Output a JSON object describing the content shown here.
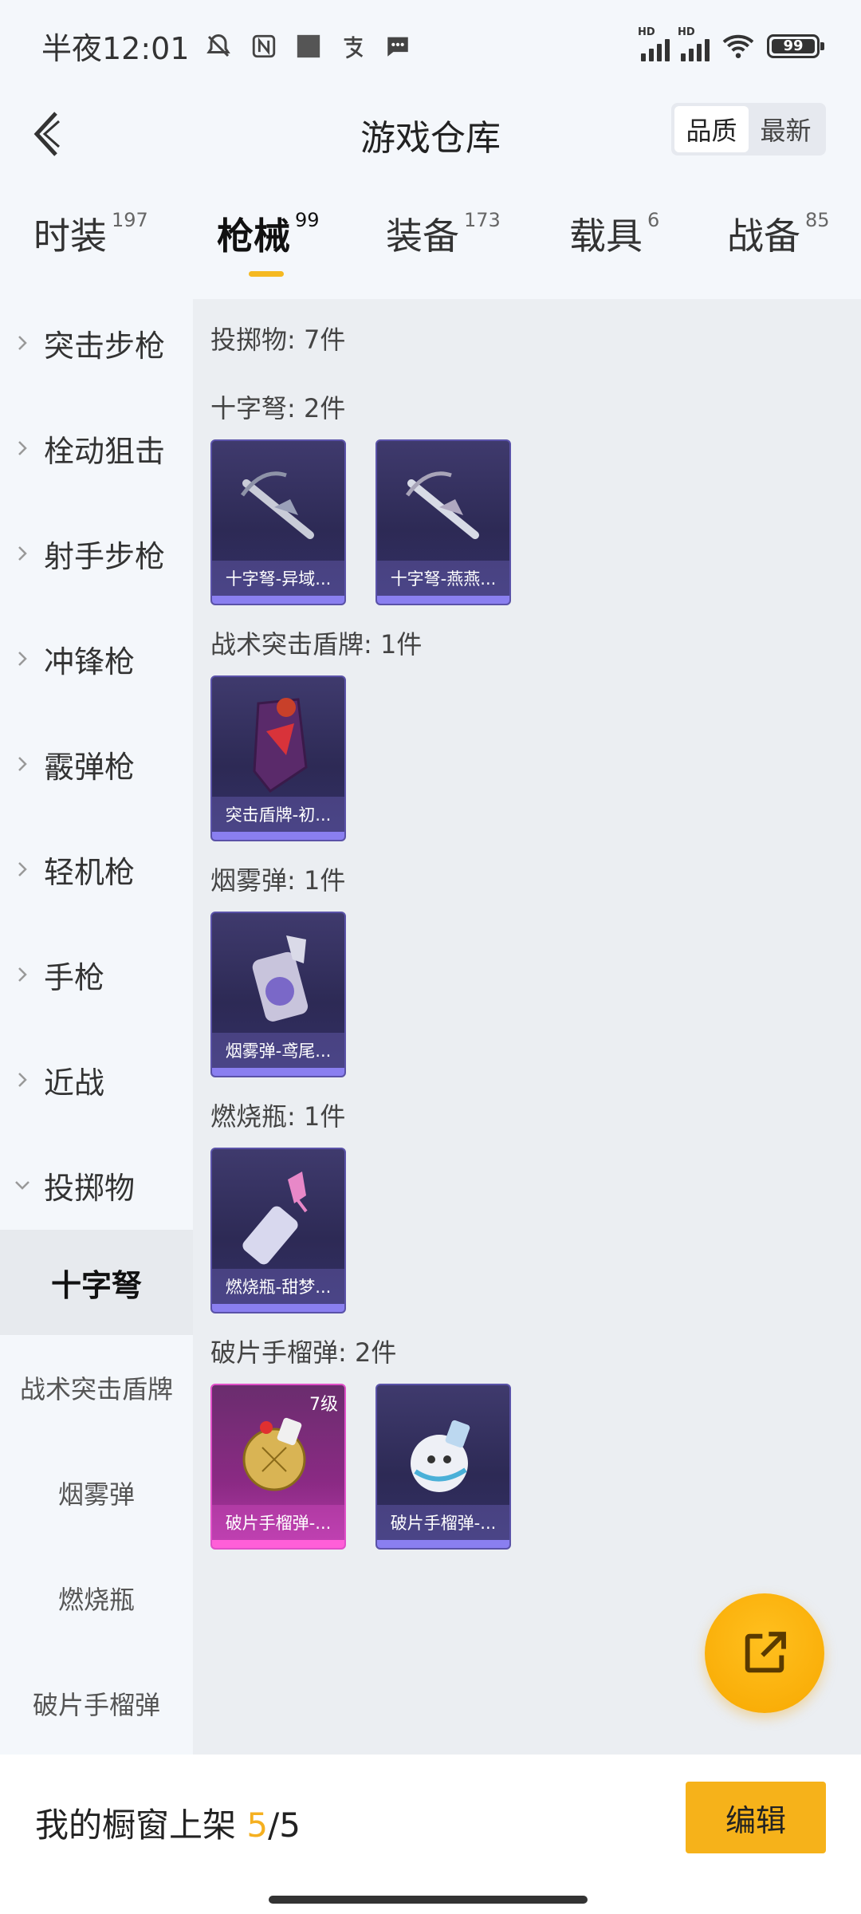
{
  "status_bar": {
    "time": "半夜12:01",
    "signal_label_1": "HD",
    "signal_label_2": "HD",
    "battery": "99"
  },
  "header": {
    "title": "游戏仓库",
    "sort_options": [
      "品质",
      "最新"
    ],
    "selected_sort": "品质"
  },
  "tabs": [
    {
      "label": "时装",
      "count": "197"
    },
    {
      "label": "枪械",
      "count": "99"
    },
    {
      "label": "装备",
      "count": "173"
    },
    {
      "label": "载具",
      "count": "6"
    },
    {
      "label": "战备",
      "count": "85"
    }
  ],
  "active_tab": "枪械",
  "sidebar": {
    "categories": [
      "突击步枪",
      "栓动狙击",
      "射手步枪",
      "冲锋枪",
      "霰弹枪",
      "轻机枪",
      "手枪",
      "近战",
      "投掷物"
    ],
    "expanded": "投掷物",
    "subcategories": [
      "十字弩",
      "战术突击盾牌",
      "烟雾弹",
      "燃烧瓶",
      "破片手榴弹"
    ],
    "selected_sub": "十字弩"
  },
  "content": {
    "summary": "投掷物: 7件",
    "sections": [
      {
        "label": "十字弩: 2件",
        "items": [
          {
            "name": "十字弩-异域..."
          },
          {
            "name": "十字弩-燕燕..."
          }
        ]
      },
      {
        "label": "战术突击盾牌: 1件",
        "items": [
          {
            "name": "突击盾牌-初..."
          }
        ]
      },
      {
        "label": "烟雾弹: 1件",
        "items": [
          {
            "name": "烟雾弹-鸢尾..."
          }
        ]
      },
      {
        "label": "燃烧瓶: 1件",
        "items": [
          {
            "name": "燃烧瓶-甜梦..."
          }
        ]
      },
      {
        "label": "破片手榴弹: 2件",
        "items": [
          {
            "name": "破片手榴弹-...",
            "level": "7级"
          },
          {
            "name": "破片手榴弹-..."
          }
        ]
      }
    ]
  },
  "bottom": {
    "shelf_label": "我的橱窗上架",
    "shelf_current": "5",
    "shelf_total": "/5",
    "edit_label": "编辑"
  },
  "colors": {
    "accent": "#f6b21a",
    "card_purple": "#2d2a55",
    "card_gold": "#8b2a84"
  }
}
